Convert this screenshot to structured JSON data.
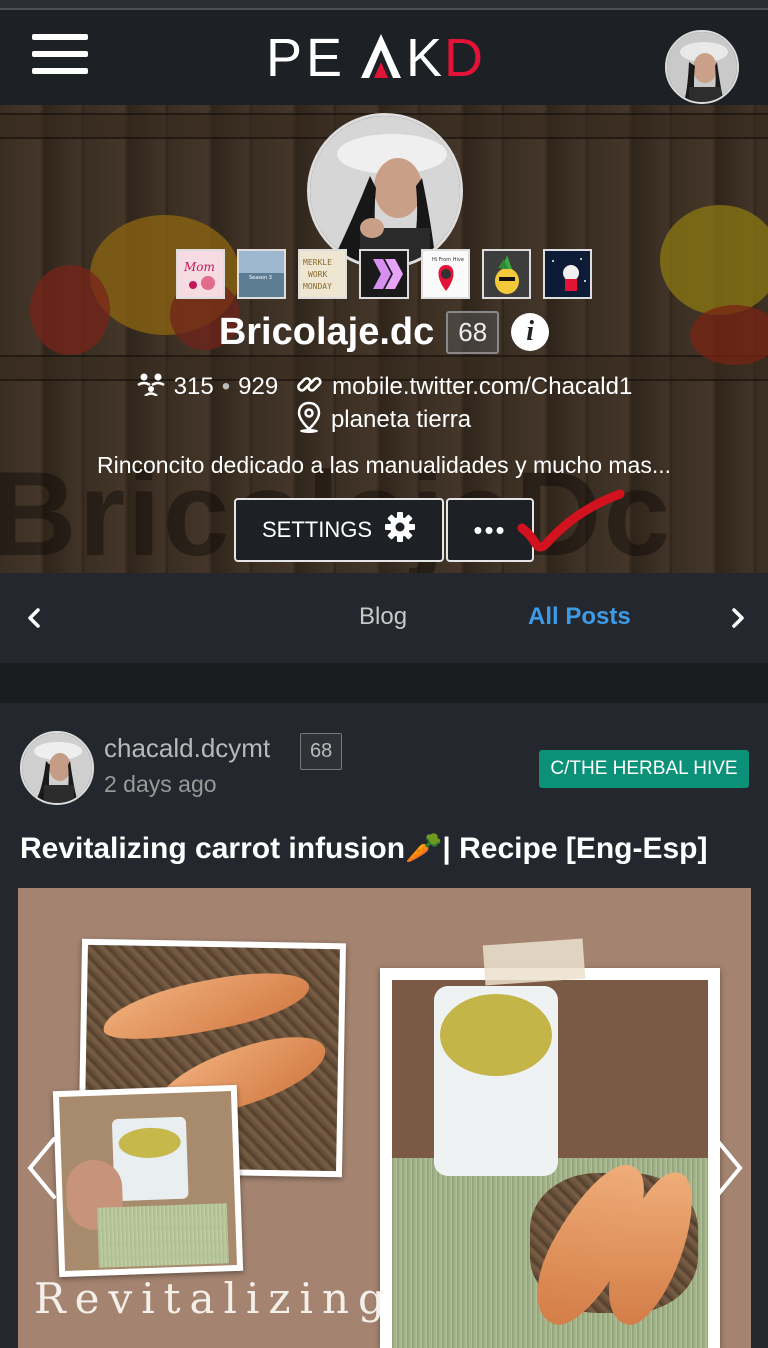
{
  "navbar": {
    "menu_icon": "hamburger-icon",
    "logo": "PEAKD",
    "avatar_icon": "user-avatar"
  },
  "profile": {
    "cover_text": "BricolajeDc",
    "name": "Bricolaje.dc",
    "reputation": "68",
    "followers": "315",
    "separator": "•",
    "following": "929",
    "website": "mobile.twitter.com/Chacald1",
    "location": "planeta tierra",
    "about": "Rinconcito dedicado a las manualidades y mucho mas...",
    "settings_label": "SETTINGS",
    "more_label": "•••",
    "badges": [
      "badge-mom",
      "badge-photo-game",
      "badge-merkle-work-monday",
      "badge-hive",
      "badge-hi-from-hive",
      "badge-pineapple",
      "badge-discovery"
    ]
  },
  "tabs": {
    "items": [
      "Blog",
      "All Posts"
    ],
    "active": "All Posts"
  },
  "post": {
    "author": "chacald.dcymt",
    "reputation": "68",
    "time": "2 days ago",
    "community": "C/THE HERBAL HIVE",
    "title": "Revitalizing carrot infusion🥕| Recipe [Eng-Esp]",
    "image_text": "Revitalizing"
  },
  "colors": {
    "background": "#1d2025",
    "accent_blue": "#3d9be6",
    "brand_red": "#e31337",
    "community_green": "#0b9177"
  }
}
